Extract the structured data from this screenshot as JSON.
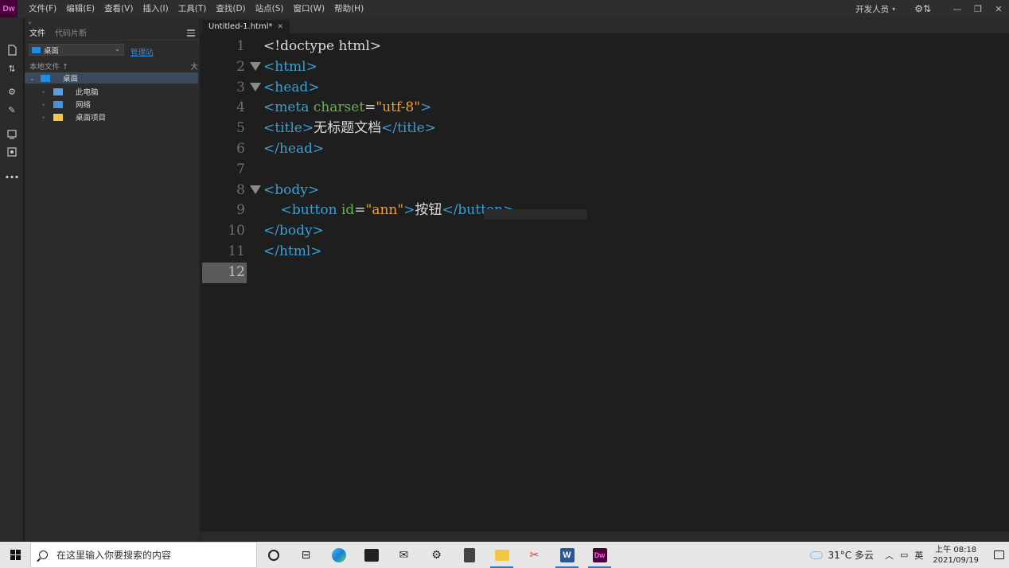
{
  "app": {
    "logo": "Dw",
    "menu": [
      "文件(F)",
      "编辑(E)",
      "查看(V)",
      "插入(I)",
      "工具(T)",
      "查找(D)",
      "站点(S)",
      "窗口(W)",
      "帮助(H)"
    ],
    "workspace": "开发人员",
    "window_controls": [
      "minimize",
      "restore",
      "close"
    ]
  },
  "panel": {
    "tabs": [
      "文件",
      "代码片断"
    ],
    "site_selector": "桌面",
    "manage_link": "管理站",
    "tree_header": "本地文件",
    "tree_header_right": "大",
    "tree": [
      {
        "label": "桌面",
        "level": 0,
        "expanded": true,
        "selected": true,
        "icon": "desktop-icon"
      },
      {
        "label": "此电脑",
        "level": 1,
        "expanded": false,
        "icon": "computer-icon"
      },
      {
        "label": "网络",
        "level": 1,
        "expanded": false,
        "icon": "network-icon"
      },
      {
        "label": "桌面项目",
        "level": 1,
        "expanded": false,
        "icon": "folder-icon"
      }
    ]
  },
  "editor": {
    "tab_label": "Untitled-1.html*",
    "current_line": 12,
    "lines": [
      {
        "n": "1",
        "tokens": [
          {
            "t": "<!doctype html>",
            "k": "text"
          }
        ]
      },
      {
        "n": "2",
        "fold": true,
        "tokens": [
          {
            "t": "<html>",
            "k": "tag"
          }
        ]
      },
      {
        "n": "3",
        "fold": true,
        "tokens": [
          {
            "t": "<head>",
            "k": "tag"
          }
        ]
      },
      {
        "n": "4",
        "tokens": [
          {
            "t": "<meta ",
            "k": "tag"
          },
          {
            "t": "charset",
            "k": "attr"
          },
          {
            "t": "=",
            "k": "eq"
          },
          {
            "t": "\"utf-8\"",
            "k": "val"
          },
          {
            "t": ">",
            "k": "tag"
          }
        ]
      },
      {
        "n": "5",
        "tokens": [
          {
            "t": "<title>",
            "k": "tag"
          },
          {
            "t": "无标题文档",
            "k": "text"
          },
          {
            "t": "</title>",
            "k": "tag"
          }
        ]
      },
      {
        "n": "6",
        "tokens": [
          {
            "t": "</head>",
            "k": "tag"
          }
        ]
      },
      {
        "n": "7",
        "tokens": []
      },
      {
        "n": "8",
        "fold": true,
        "tokens": [
          {
            "t": "<body>",
            "k": "tag"
          }
        ]
      },
      {
        "n": "9",
        "tokens": [
          {
            "t": "    ",
            "k": "text"
          },
          {
            "t": "<button ",
            "k": "tag"
          },
          {
            "t": "id",
            "k": "attr"
          },
          {
            "t": "=",
            "k": "eq"
          },
          {
            "t": "\"ann\"",
            "k": "val"
          },
          {
            "t": ">",
            "k": "tag"
          },
          {
            "t": "按钮",
            "k": "text"
          },
          {
            "t": "</button>",
            "k": "tag"
          }
        ]
      },
      {
        "n": "10",
        "tokens": [
          {
            "t": "</body>",
            "k": "tag"
          }
        ]
      },
      {
        "n": "11",
        "tokens": [
          {
            "t": "</html>",
            "k": "tag"
          }
        ]
      },
      {
        "n": "12",
        "tokens": []
      }
    ]
  },
  "taskbar": {
    "search_placeholder": "在这里输入你要搜索的内容",
    "weather": "31°C 多云",
    "ime": "英",
    "time": "上午 08:18",
    "date": "2021/09/19",
    "colors": {
      "accent": "#1a7fd4",
      "dw_brand": "#470137",
      "dw_text": "#ff61f6"
    }
  }
}
